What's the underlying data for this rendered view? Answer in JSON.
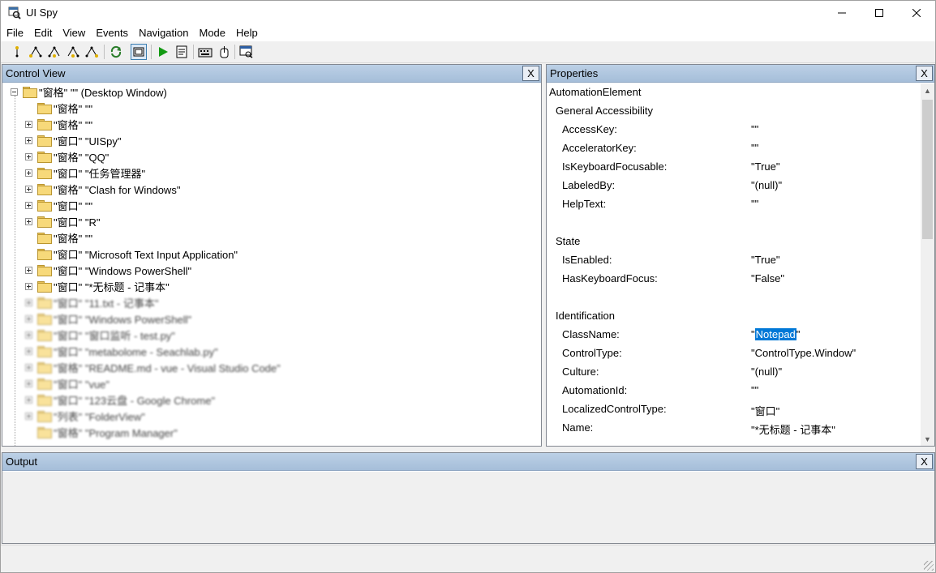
{
  "window": {
    "title": "UI Spy",
    "minimize": "—",
    "maximize": "☐",
    "close": "✕"
  },
  "menu": [
    "File",
    "Edit",
    "View",
    "Events",
    "Navigation",
    "Mode",
    "Help"
  ],
  "toolbar": {
    "buttons": [
      "navigate-parent-icon",
      "navigate-first-child-icon",
      "navigate-next-sibling-icon",
      "navigate-previous-sibling-icon",
      "navigate-last-child-icon",
      "refresh-icon",
      "highlight-rectangle-icon",
      "play-icon",
      "properties-icon",
      "keyboard-icon",
      "hover-mode-icon",
      "focus-tracking-icon"
    ]
  },
  "control_view": {
    "title": "Control View",
    "close": "X",
    "tree": [
      {
        "label": "\"窗格\" \"\" (Desktop Window)",
        "level": 0,
        "expander": "minus",
        "blurred": false
      },
      {
        "label": "\"窗格\" \"\"",
        "level": 1,
        "expander": "none",
        "blurred": false
      },
      {
        "label": "\"窗格\" \"\"",
        "level": 1,
        "expander": "plus",
        "blurred": false
      },
      {
        "label": "\"窗口\" \"UISpy\"",
        "level": 1,
        "expander": "plus",
        "blurred": false
      },
      {
        "label": "\"窗格\" \"QQ\"",
        "level": 1,
        "expander": "plus",
        "blurred": false
      },
      {
        "label": "\"窗口\" \"任务管理器\"",
        "level": 1,
        "expander": "plus",
        "blurred": false
      },
      {
        "label": "\"窗格\" \"Clash for Windows\"",
        "level": 1,
        "expander": "plus",
        "blurred": false
      },
      {
        "label": "\"窗口\" \"\"",
        "level": 1,
        "expander": "plus",
        "blurred": false
      },
      {
        "label": "\"窗口\" \"R\"",
        "level": 1,
        "expander": "plus",
        "blurred": false
      },
      {
        "label": "\"窗格\" \"\"",
        "level": 1,
        "expander": "none",
        "blurred": false
      },
      {
        "label": "\"窗口\" \"Microsoft Text Input Application\"",
        "level": 1,
        "expander": "none",
        "blurred": false
      },
      {
        "label": "\"窗口\" \"Windows PowerShell\"",
        "level": 1,
        "expander": "plus",
        "blurred": false
      },
      {
        "label": "\"窗口\" \"*无标题 - 记事本\"",
        "level": 1,
        "expander": "plus",
        "blurred": false
      },
      {
        "label": "\"窗口\" \"11.txt - 记事本\"",
        "level": 1,
        "expander": "plus",
        "blurred": true
      },
      {
        "label": "\"窗口\" \"Windows PowerShell\"",
        "level": 1,
        "expander": "plus",
        "blurred": true
      },
      {
        "label": "\"窗口\" \"窗口监听 - test.py\"",
        "level": 1,
        "expander": "plus",
        "blurred": true
      },
      {
        "label": "\"窗口\" \"metabolome - Seachlab.py\"",
        "level": 1,
        "expander": "plus",
        "blurred": true
      },
      {
        "label": "\"窗格\" \"README.md - vue - Visual Studio Code\"",
        "level": 1,
        "expander": "plus",
        "blurred": true
      },
      {
        "label": "\"窗口\" \"vue\"",
        "level": 1,
        "expander": "plus",
        "blurred": true
      },
      {
        "label": "\"窗口\" \"123云盘 - Google Chrome\"",
        "level": 1,
        "expander": "plus",
        "blurred": true
      },
      {
        "label": "\"列表\" \"FolderView\"",
        "level": 1,
        "expander": "plus",
        "blurred": true
      },
      {
        "label": "\"窗格\" \"Program Manager\"",
        "level": 1,
        "expander": "none",
        "blurred": true
      }
    ]
  },
  "properties": {
    "title": "Properties",
    "close": "X",
    "rows": [
      {
        "kind": "root",
        "name": "AutomationElement",
        "value": ""
      },
      {
        "kind": "group",
        "name": "General Accessibility",
        "value": ""
      },
      {
        "kind": "prop",
        "name": "AccessKey:",
        "value": "\"\""
      },
      {
        "kind": "prop",
        "name": "AcceleratorKey:",
        "value": "\"\""
      },
      {
        "kind": "prop",
        "name": "IsKeyboardFocusable:",
        "value": "\"True\""
      },
      {
        "kind": "prop",
        "name": "LabeledBy:",
        "value": "\"(null)\""
      },
      {
        "kind": "prop",
        "name": "HelpText:",
        "value": "\"\""
      },
      {
        "kind": "blank",
        "name": "",
        "value": ""
      },
      {
        "kind": "group",
        "name": "State",
        "value": ""
      },
      {
        "kind": "prop",
        "name": "IsEnabled:",
        "value": "\"True\""
      },
      {
        "kind": "prop",
        "name": "HasKeyboardFocus:",
        "value": "\"False\""
      },
      {
        "kind": "blank",
        "name": "",
        "value": ""
      },
      {
        "kind": "group",
        "name": "Identification",
        "value": ""
      },
      {
        "kind": "prop",
        "name": "ClassName:",
        "value": "\"Notepad\"",
        "selected": "Notepad"
      },
      {
        "kind": "prop",
        "name": "ControlType:",
        "value": "\"ControlType.Window\""
      },
      {
        "kind": "prop",
        "name": "Culture:",
        "value": "\"(null)\""
      },
      {
        "kind": "prop",
        "name": "AutomationId:",
        "value": "\"\""
      },
      {
        "kind": "prop",
        "name": "LocalizedControlType:",
        "value": "\"窗口\""
      },
      {
        "kind": "prop",
        "name": "Name:",
        "value": "\"*无标题 - 记事本\""
      }
    ]
  },
  "output": {
    "title": "Output",
    "close": "X"
  }
}
